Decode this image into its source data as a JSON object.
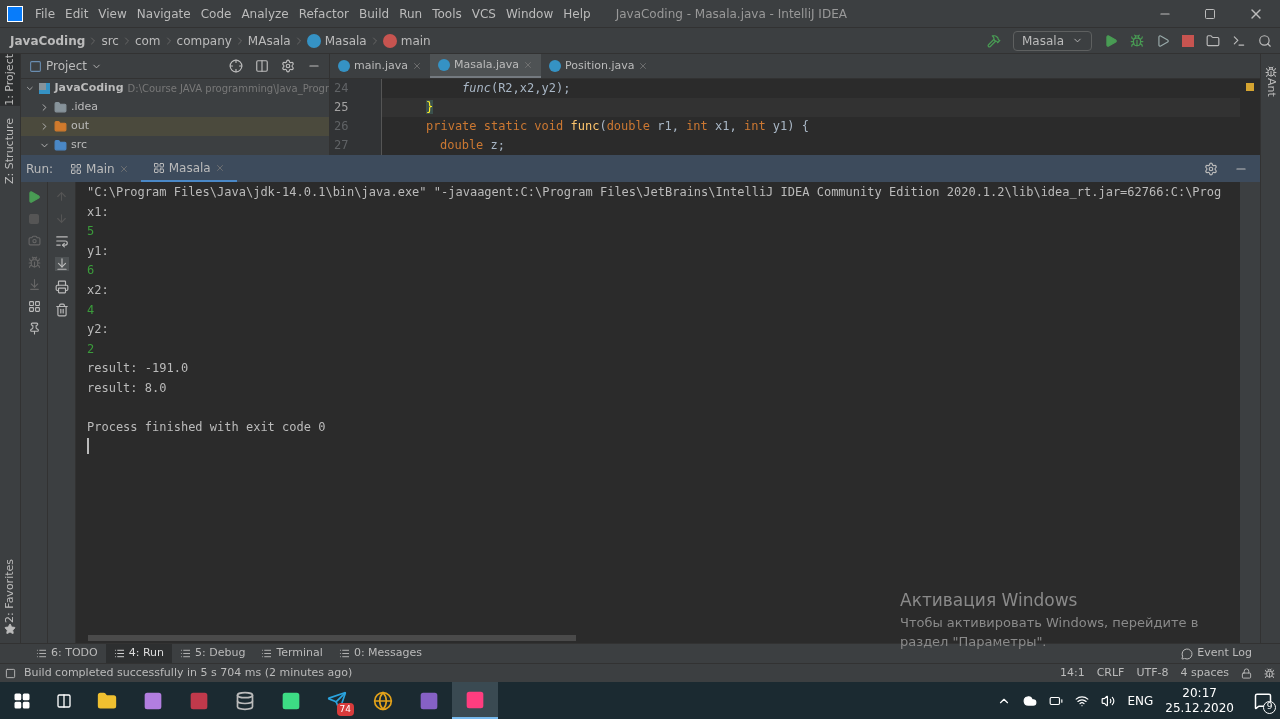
{
  "window": {
    "title": "JavaCoding - Masala.java - IntelliJ IDEA"
  },
  "menu": [
    "File",
    "Edit",
    "View",
    "Navigate",
    "Code",
    "Analyze",
    "Refactor",
    "Build",
    "Run",
    "Tools",
    "VCS",
    "Window",
    "Help"
  ],
  "breadcrumbs": [
    {
      "label": "JavaCoding",
      "kind": "project"
    },
    {
      "label": "src",
      "kind": "folder"
    },
    {
      "label": "com",
      "kind": "folder"
    },
    {
      "label": "company",
      "kind": "folder"
    },
    {
      "label": "MAsala",
      "kind": "folder"
    },
    {
      "label": "Masala",
      "kind": "class"
    },
    {
      "label": "main",
      "kind": "method"
    }
  ],
  "run_config": "Masala",
  "left_strip": [
    {
      "label": "1: Project",
      "selected": true
    },
    {
      "label": "Z: Structure",
      "selected": false
    }
  ],
  "favorites": "2: Favorites",
  "right_strip": "Ant",
  "project_panel": {
    "title": "Project",
    "tree": [
      {
        "name": "JavaCoding",
        "path": "D:\\Course JAVA programming\\Java_Progr",
        "kind": "module",
        "expanded": true,
        "selected": false,
        "children": [
          {
            "name": ".idea",
            "kind": "folder",
            "expanded": false,
            "selected": false
          },
          {
            "name": "out",
            "kind": "excluded",
            "expanded": false,
            "selected": true
          },
          {
            "name": "src",
            "kind": "source",
            "expanded": true,
            "selected": false
          }
        ]
      }
    ]
  },
  "editor_tabs": [
    {
      "label": "main.java",
      "selected": false
    },
    {
      "label": "Masala.java",
      "selected": true
    },
    {
      "label": "Position.java",
      "selected": false
    }
  ],
  "code_lines": [
    {
      "number": "24",
      "current": false,
      "kind": "statement",
      "tokens": [
        {
          "text": "func",
          "kind": "call"
        },
        {
          "text": "(R2,x2,y2);",
          "kind": "plain"
        }
      ]
    },
    {
      "number": "25",
      "current": true,
      "kind": "member",
      "tokens": [
        {
          "text": "}",
          "kind": "brace"
        }
      ]
    },
    {
      "number": "26",
      "current": false,
      "kind": "member",
      "tokens": [
        {
          "text": "private static void ",
          "kind": "keyword"
        },
        {
          "text": "func",
          "kind": "method"
        },
        {
          "text": "(",
          "kind": "plain"
        },
        {
          "text": "double ",
          "kind": "keyword"
        },
        {
          "text": "r1, ",
          "kind": "plain"
        },
        {
          "text": "int ",
          "kind": "keyword"
        },
        {
          "text": "x1, ",
          "kind": "plain"
        },
        {
          "text": "int ",
          "kind": "keyword"
        },
        {
          "text": "y1) {",
          "kind": "plain"
        }
      ]
    },
    {
      "number": "27",
      "current": false,
      "kind": "local",
      "tokens": [
        {
          "text": "double ",
          "kind": "keyword"
        },
        {
          "text": "z;",
          "kind": "plain"
        }
      ]
    }
  ],
  "run_panel": {
    "label": "Run:",
    "tabs": [
      {
        "label": "Main",
        "selected": false
      },
      {
        "label": "Masala",
        "selected": true
      }
    ],
    "console": [
      {
        "text": "\"C:\\Program Files\\Java\\jdk-14.0.1\\bin\\java.exe\" \"-javaagent:C:\\Program Files\\JetBrains\\IntelliJ IDEA Community Edition 2020.1.2\\lib\\idea_rt.jar=62766:C:\\Prog",
        "kind": "output"
      },
      {
        "text": "x1:",
        "kind": "output"
      },
      {
        "text": "5",
        "kind": "input"
      },
      {
        "text": "y1:",
        "kind": "output"
      },
      {
        "text": "6",
        "kind": "input"
      },
      {
        "text": "x2:",
        "kind": "output"
      },
      {
        "text": "4",
        "kind": "input"
      },
      {
        "text": "y2:",
        "kind": "output"
      },
      {
        "text": "2",
        "kind": "input"
      },
      {
        "text": "result: -191.0",
        "kind": "output"
      },
      {
        "text": "result: 8.0",
        "kind": "output"
      },
      {
        "kind": "blank"
      },
      {
        "text": "Process finished with exit code 0",
        "kind": "output"
      }
    ]
  },
  "bottom_tabs": [
    {
      "label": "6: TODO",
      "selected": false
    },
    {
      "label": "4: Run",
      "selected": true
    },
    {
      "label": "5: Debug",
      "selected": false
    },
    {
      "label": "Terminal",
      "selected": false
    },
    {
      "label": "0: Messages",
      "selected": false
    }
  ],
  "event_log": "Event Log",
  "status_bar": {
    "message": "Build completed successfully in 5 s 704 ms (2 minutes ago)",
    "items": [
      "14:1",
      "CRLF",
      "UTF-8",
      "4 spaces"
    ]
  },
  "activation": {
    "title": "Активация Windows",
    "text": "Чтобы активировать Windows, перейдите в раздел \"Параметры\"."
  },
  "taskbar": {
    "apps": [
      {
        "kind": "explorer",
        "active": false
      },
      {
        "kind": "vs",
        "active": false
      },
      {
        "kind": "access",
        "active": false
      },
      {
        "kind": "db",
        "active": false
      },
      {
        "kind": "android",
        "active": false
      },
      {
        "kind": "telegram",
        "active": false,
        "badge": "74"
      },
      {
        "kind": "chrome",
        "active": false
      },
      {
        "kind": "vs2",
        "active": false
      },
      {
        "kind": "intellij",
        "active": true
      }
    ],
    "language": "ENG",
    "time": "20:17",
    "date": "25.12.2020",
    "notifications": "9"
  }
}
